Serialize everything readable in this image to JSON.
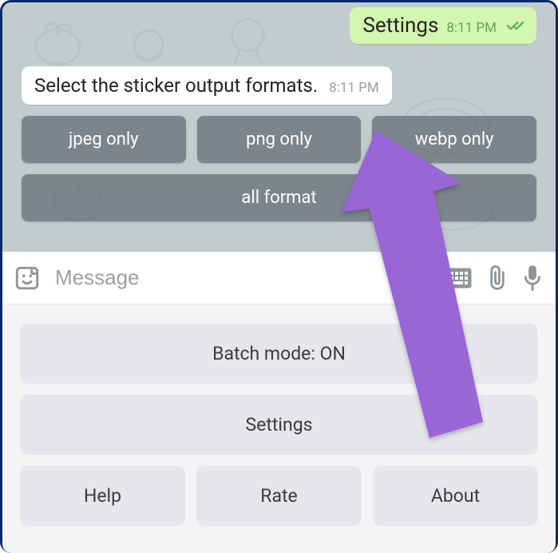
{
  "outgoing": {
    "text": "Settings",
    "time": "8:11 PM"
  },
  "incoming": {
    "text": "Select the sticker output formats.",
    "time": "8:11 PM"
  },
  "inline_keyboard": {
    "row1": {
      "btn1": "jpeg only",
      "btn2": "png only",
      "btn3": "webp only"
    },
    "row2": {
      "btn1": "all format"
    }
  },
  "input": {
    "placeholder": "Message"
  },
  "reply_keyboard": {
    "row1": {
      "btn1": "Batch mode: ON"
    },
    "row2": {
      "btn1": "Settings"
    },
    "row3": {
      "btn1": "Help",
      "btn2": "Rate",
      "btn3": "About"
    }
  },
  "colors": {
    "arrow": "#9a65d6",
    "out_bubble": "#d4f7b1",
    "ticks": "#55b24f"
  }
}
